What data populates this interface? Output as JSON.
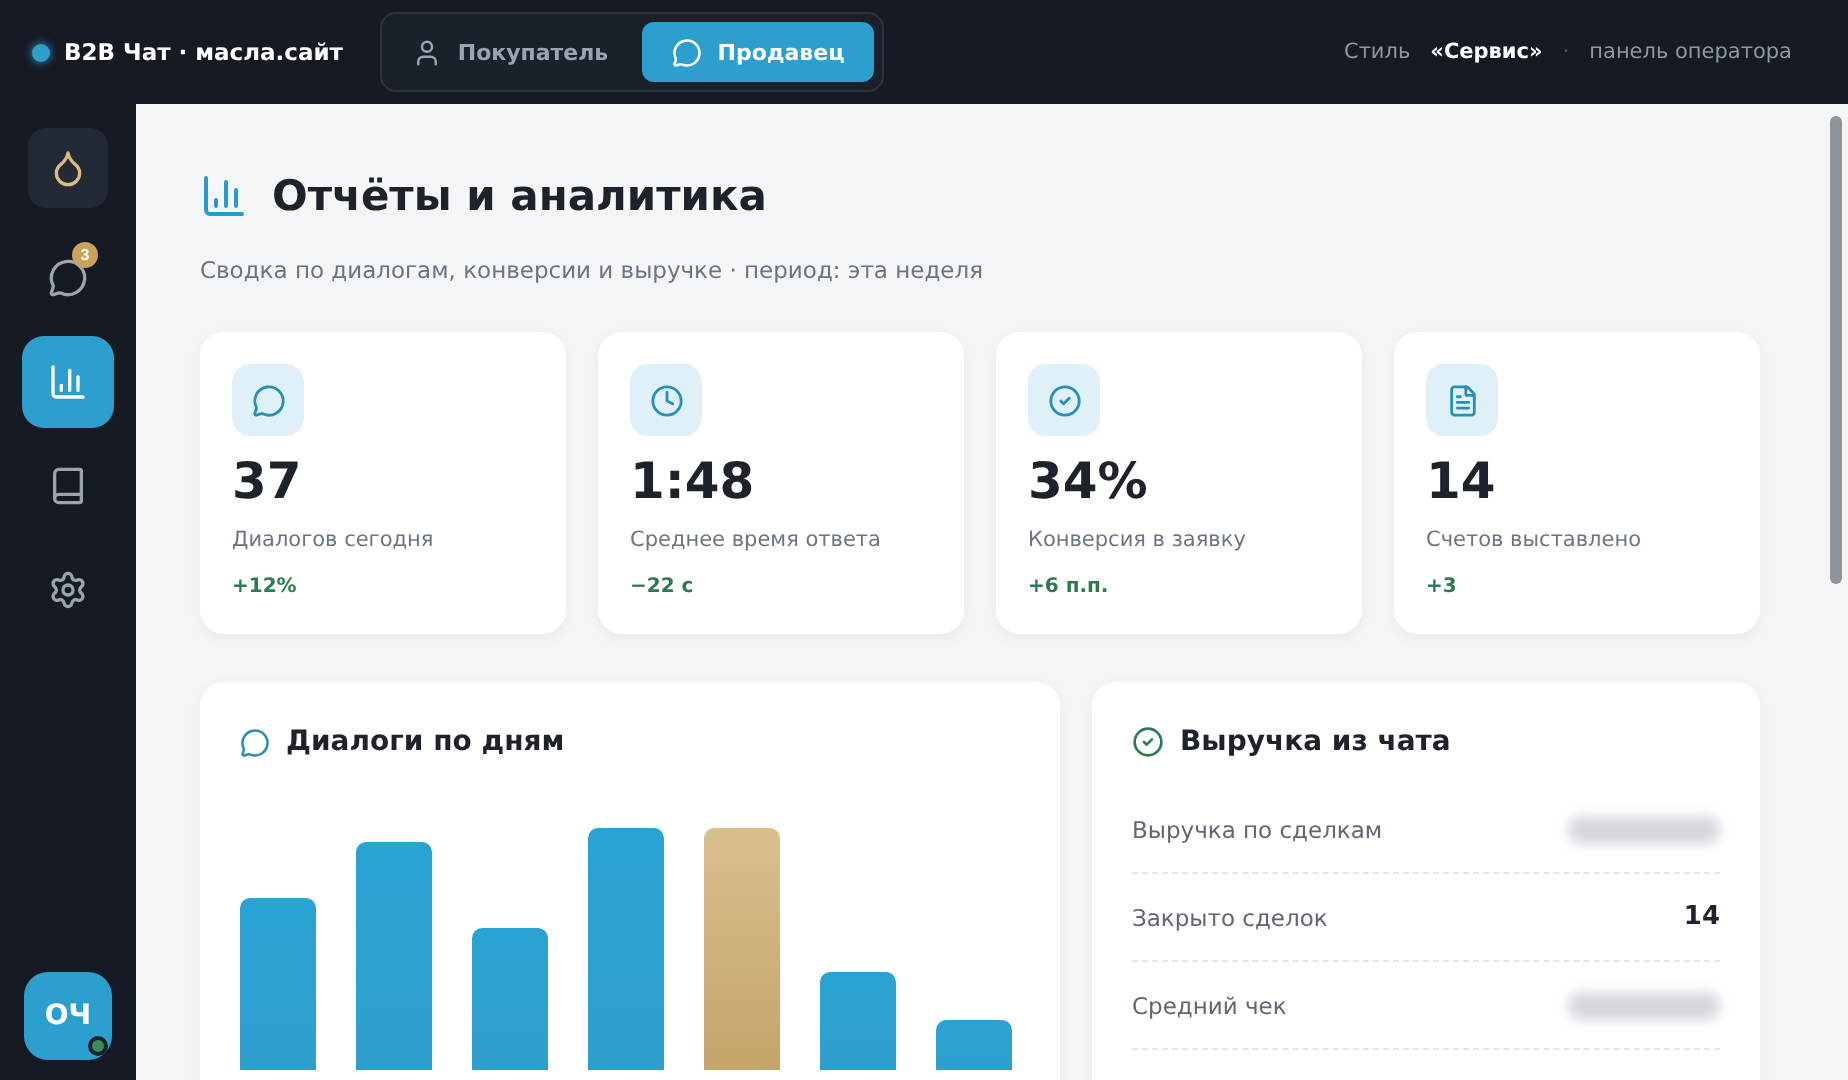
{
  "header": {
    "brand": "B2B Чат · масла.сайт",
    "roles": [
      {
        "label": "Покупатель",
        "kind": "user",
        "selected": false
      },
      {
        "label": "Продавец",
        "kind": "chat",
        "selected": true
      }
    ],
    "style_label": "Стиль",
    "style_name": "«Сервис»",
    "separator": "·",
    "panel_label": "панель оператора"
  },
  "sidebar": {
    "items": [
      {
        "kind": "chat",
        "badge": "3",
        "selected": false
      },
      {
        "kind": "chart",
        "selected": true
      },
      {
        "kind": "book",
        "selected": false
      },
      {
        "kind": "settings",
        "selected": false
      }
    ],
    "avatar": {
      "initials": "ОЧ",
      "online": true
    }
  },
  "page": {
    "title": "Отчёты и аналитика",
    "subtitle": "Сводка по диалогам, конверсии и выручке · период: эта неделя"
  },
  "stats": [
    {
      "kind": "chat",
      "value": "37",
      "label": "Диалогов сегодня",
      "delta": "+12%"
    },
    {
      "kind": "clock",
      "value": "1:48",
      "label": "Среднее время ответа",
      "delta": "−22 с"
    },
    {
      "kind": "check",
      "value": "34%",
      "label": "Конверсия в заявку",
      "delta": "+6 п.п."
    },
    {
      "kind": "file",
      "value": "14",
      "label": "Счетов выставлено",
      "delta": "+3"
    }
  ],
  "chart_panel": {
    "title": "Диалоги по дням"
  },
  "revenue": {
    "title": "Выручка из чата",
    "rows": [
      {
        "label": "Выручка по сделкам",
        "blurred": true
      },
      {
        "label": "Закрыто сделок",
        "value": "14",
        "blurred": false
      },
      {
        "label": "Средний чек",
        "blurred": true
      }
    ]
  }
}
